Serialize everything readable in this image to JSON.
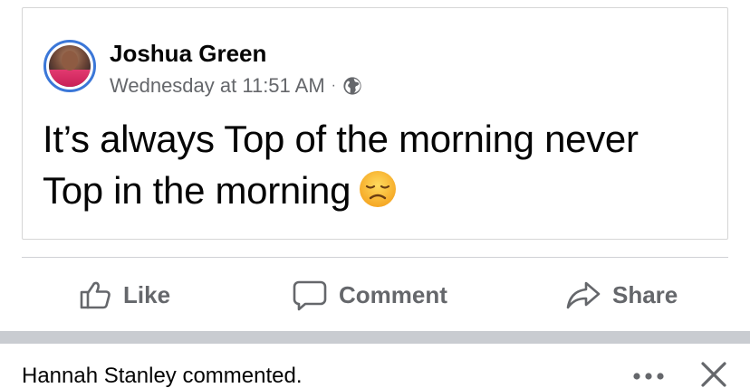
{
  "post": {
    "author_name": "Joshua Green",
    "timestamp": "Wednesday at 11:51 AM",
    "meta_separator": "·",
    "privacy_icon": "globe-icon",
    "text_line_1": "It’s always Top of the morning never",
    "text_line_2": "Top in the morning",
    "emoji": "disappointed-face-emoji"
  },
  "actions": {
    "like_label": "Like",
    "comment_label": "Comment",
    "share_label": "Share"
  },
  "notification": {
    "text": "Hannah Stanley commented.",
    "more_icon": "more-horizontal-icon",
    "close_icon": "close-icon"
  },
  "colors": {
    "avatar_ring": "#3b77d8",
    "secondary_text": "#65676b",
    "separator": "#c9ccd1"
  }
}
